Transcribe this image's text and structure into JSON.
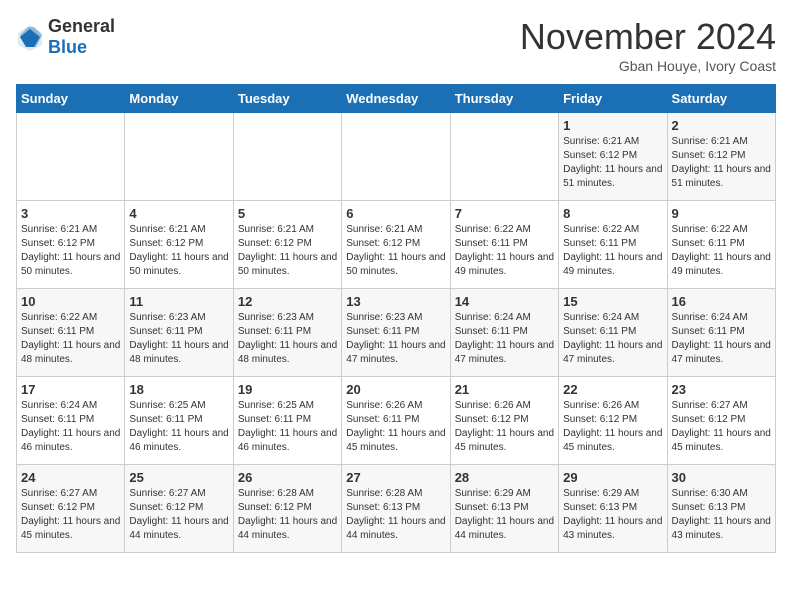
{
  "logo": {
    "general": "General",
    "blue": "Blue"
  },
  "title": "November 2024",
  "subtitle": "Gban Houye, Ivory Coast",
  "days_of_week": [
    "Sunday",
    "Monday",
    "Tuesday",
    "Wednesday",
    "Thursday",
    "Friday",
    "Saturday"
  ],
  "weeks": [
    [
      {
        "day": "",
        "info": ""
      },
      {
        "day": "",
        "info": ""
      },
      {
        "day": "",
        "info": ""
      },
      {
        "day": "",
        "info": ""
      },
      {
        "day": "",
        "info": ""
      },
      {
        "day": "1",
        "info": "Sunrise: 6:21 AM\nSunset: 6:12 PM\nDaylight: 11 hours and 51 minutes."
      },
      {
        "day": "2",
        "info": "Sunrise: 6:21 AM\nSunset: 6:12 PM\nDaylight: 11 hours and 51 minutes."
      }
    ],
    [
      {
        "day": "3",
        "info": "Sunrise: 6:21 AM\nSunset: 6:12 PM\nDaylight: 11 hours and 50 minutes."
      },
      {
        "day": "4",
        "info": "Sunrise: 6:21 AM\nSunset: 6:12 PM\nDaylight: 11 hours and 50 minutes."
      },
      {
        "day": "5",
        "info": "Sunrise: 6:21 AM\nSunset: 6:12 PM\nDaylight: 11 hours and 50 minutes."
      },
      {
        "day": "6",
        "info": "Sunrise: 6:21 AM\nSunset: 6:12 PM\nDaylight: 11 hours and 50 minutes."
      },
      {
        "day": "7",
        "info": "Sunrise: 6:22 AM\nSunset: 6:11 PM\nDaylight: 11 hours and 49 minutes."
      },
      {
        "day": "8",
        "info": "Sunrise: 6:22 AM\nSunset: 6:11 PM\nDaylight: 11 hours and 49 minutes."
      },
      {
        "day": "9",
        "info": "Sunrise: 6:22 AM\nSunset: 6:11 PM\nDaylight: 11 hours and 49 minutes."
      }
    ],
    [
      {
        "day": "10",
        "info": "Sunrise: 6:22 AM\nSunset: 6:11 PM\nDaylight: 11 hours and 48 minutes."
      },
      {
        "day": "11",
        "info": "Sunrise: 6:23 AM\nSunset: 6:11 PM\nDaylight: 11 hours and 48 minutes."
      },
      {
        "day": "12",
        "info": "Sunrise: 6:23 AM\nSunset: 6:11 PM\nDaylight: 11 hours and 48 minutes."
      },
      {
        "day": "13",
        "info": "Sunrise: 6:23 AM\nSunset: 6:11 PM\nDaylight: 11 hours and 47 minutes."
      },
      {
        "day": "14",
        "info": "Sunrise: 6:24 AM\nSunset: 6:11 PM\nDaylight: 11 hours and 47 minutes."
      },
      {
        "day": "15",
        "info": "Sunrise: 6:24 AM\nSunset: 6:11 PM\nDaylight: 11 hours and 47 minutes."
      },
      {
        "day": "16",
        "info": "Sunrise: 6:24 AM\nSunset: 6:11 PM\nDaylight: 11 hours and 47 minutes."
      }
    ],
    [
      {
        "day": "17",
        "info": "Sunrise: 6:24 AM\nSunset: 6:11 PM\nDaylight: 11 hours and 46 minutes."
      },
      {
        "day": "18",
        "info": "Sunrise: 6:25 AM\nSunset: 6:11 PM\nDaylight: 11 hours and 46 minutes."
      },
      {
        "day": "19",
        "info": "Sunrise: 6:25 AM\nSunset: 6:11 PM\nDaylight: 11 hours and 46 minutes."
      },
      {
        "day": "20",
        "info": "Sunrise: 6:26 AM\nSunset: 6:11 PM\nDaylight: 11 hours and 45 minutes."
      },
      {
        "day": "21",
        "info": "Sunrise: 6:26 AM\nSunset: 6:12 PM\nDaylight: 11 hours and 45 minutes."
      },
      {
        "day": "22",
        "info": "Sunrise: 6:26 AM\nSunset: 6:12 PM\nDaylight: 11 hours and 45 minutes."
      },
      {
        "day": "23",
        "info": "Sunrise: 6:27 AM\nSunset: 6:12 PM\nDaylight: 11 hours and 45 minutes."
      }
    ],
    [
      {
        "day": "24",
        "info": "Sunrise: 6:27 AM\nSunset: 6:12 PM\nDaylight: 11 hours and 45 minutes."
      },
      {
        "day": "25",
        "info": "Sunrise: 6:27 AM\nSunset: 6:12 PM\nDaylight: 11 hours and 44 minutes."
      },
      {
        "day": "26",
        "info": "Sunrise: 6:28 AM\nSunset: 6:12 PM\nDaylight: 11 hours and 44 minutes."
      },
      {
        "day": "27",
        "info": "Sunrise: 6:28 AM\nSunset: 6:13 PM\nDaylight: 11 hours and 44 minutes."
      },
      {
        "day": "28",
        "info": "Sunrise: 6:29 AM\nSunset: 6:13 PM\nDaylight: 11 hours and 44 minutes."
      },
      {
        "day": "29",
        "info": "Sunrise: 6:29 AM\nSunset: 6:13 PM\nDaylight: 11 hours and 43 minutes."
      },
      {
        "day": "30",
        "info": "Sunrise: 6:30 AM\nSunset: 6:13 PM\nDaylight: 11 hours and 43 minutes."
      }
    ]
  ]
}
